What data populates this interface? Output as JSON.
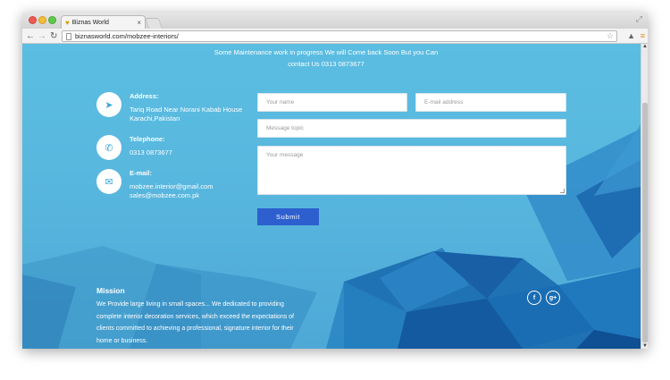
{
  "browser": {
    "tab_title": "Biznas World",
    "tab_close": "×",
    "url": "biznasworld.com/mobzee-interiors/",
    "icons": {
      "favicon": "pin-icon",
      "back": "back-arrow-icon",
      "forward": "forward-arrow-icon",
      "reload": "reload-icon",
      "star": "star-icon",
      "extension": "extension-icon",
      "menu": "hamburger-menu-icon",
      "expand": "expand-icon"
    }
  },
  "notice": {
    "line1": "Some Maintenance work in progress We will Come back Soon But you Can",
    "line2": "contact Us 0313 0873677"
  },
  "contact": {
    "address": {
      "label": "Address:",
      "lines": [
        "Tariq Road Near Norani Kabab House",
        "Karachi,Pakistan"
      ],
      "icon": "location-arrow-icon"
    },
    "telephone": {
      "label": "Telephone:",
      "lines": [
        "0313 0873677"
      ],
      "icon": "phone-icon"
    },
    "email": {
      "label": "E-mail:",
      "lines": [
        "mobzee.interior@gmail.com",
        "sales@mobzee.com.pk"
      ],
      "icon": "envelope-icon"
    }
  },
  "form": {
    "name_placeholder": "Your name",
    "email_placeholder": "E-mail address",
    "topic_placeholder": "Message topic",
    "message_placeholder": "Your message",
    "submit_label": "Submit"
  },
  "mission": {
    "title": "Mission",
    "lines": [
      "We Provide large living in small spaces... We dedicated to providing",
      "complete interior decoration services, which exceed the expectations of",
      "clients committed to achieving a professional, signature interior for their",
      "home or business."
    ]
  },
  "social": {
    "facebook": "f",
    "google_plus": "g+"
  },
  "colors": {
    "background": "#5bbde1",
    "button": "#2d5fcf",
    "text": "#ffffff"
  }
}
